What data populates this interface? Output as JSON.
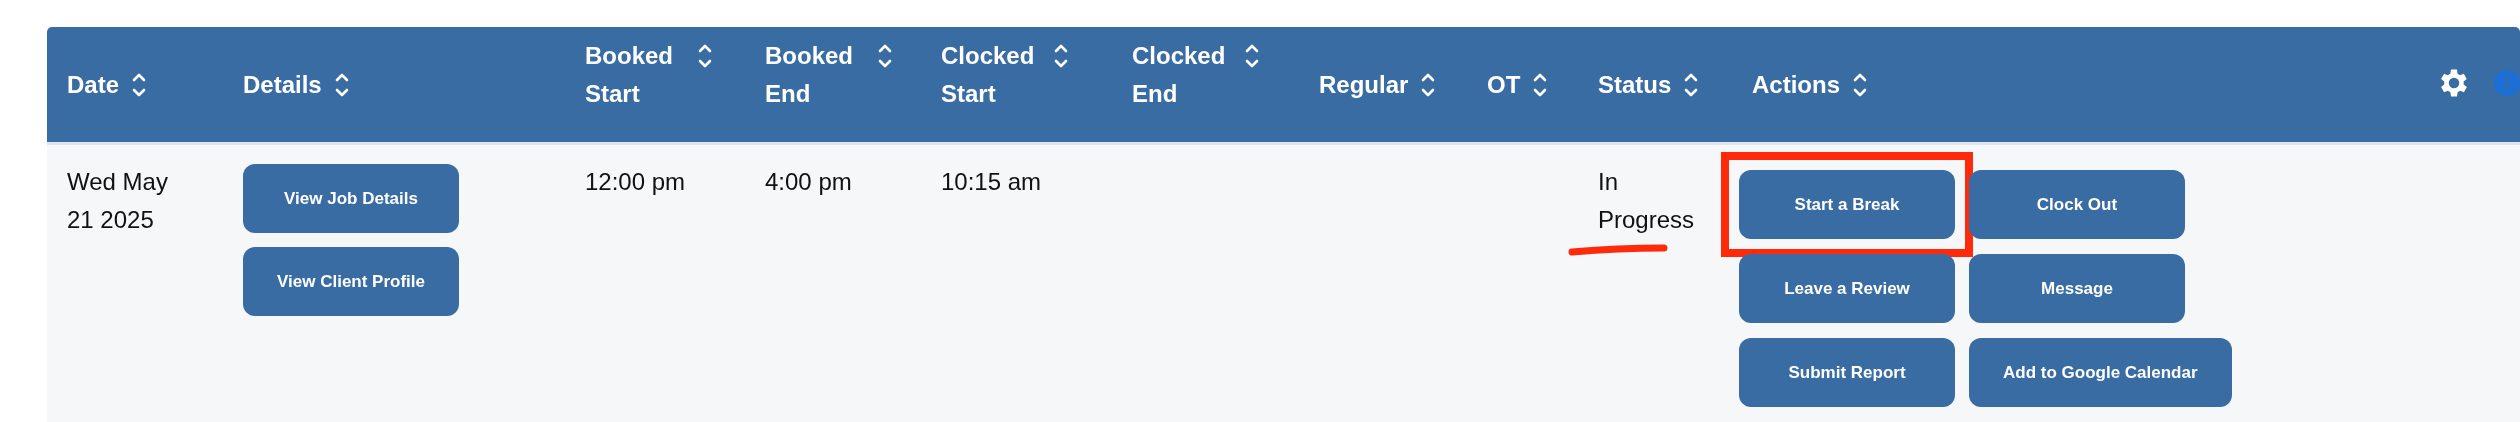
{
  "table": {
    "columns": [
      {
        "label": "Date",
        "sortable": true
      },
      {
        "label": "Details",
        "sortable": true
      },
      {
        "label": "Booked Start",
        "sortable": true
      },
      {
        "label": "Booked End",
        "sortable": true
      },
      {
        "label": "Clocked Start",
        "sortable": true
      },
      {
        "label": "Clocked End",
        "sortable": true
      },
      {
        "label": "Regular",
        "sortable": true
      },
      {
        "label": "OT",
        "sortable": true
      },
      {
        "label": "Status",
        "sortable": true
      },
      {
        "label": "Actions",
        "sortable": true
      }
    ],
    "rows": [
      {
        "date": "Wed May 21 2025",
        "details": [
          {
            "label": "View Job Details"
          },
          {
            "label": "View Client Profile"
          }
        ],
        "booked_start": "12:00 pm",
        "booked_end": "4:00 pm",
        "clocked_start": "10:15 am",
        "status": {
          "text": "In Progress",
          "underlined": true
        },
        "actions": [
          {
            "label": "Start a Break",
            "highlighted": true
          },
          {
            "label": "Clock Out",
            "highlighted": false
          },
          {
            "label": "Leave a Review",
            "highlighted": false
          },
          {
            "label": "Message",
            "highlighted": false
          },
          {
            "label": "Submit Report",
            "highlighted": false
          },
          {
            "label": "Add to Google Calendar",
            "highlighted": false
          }
        ]
      }
    ]
  }
}
